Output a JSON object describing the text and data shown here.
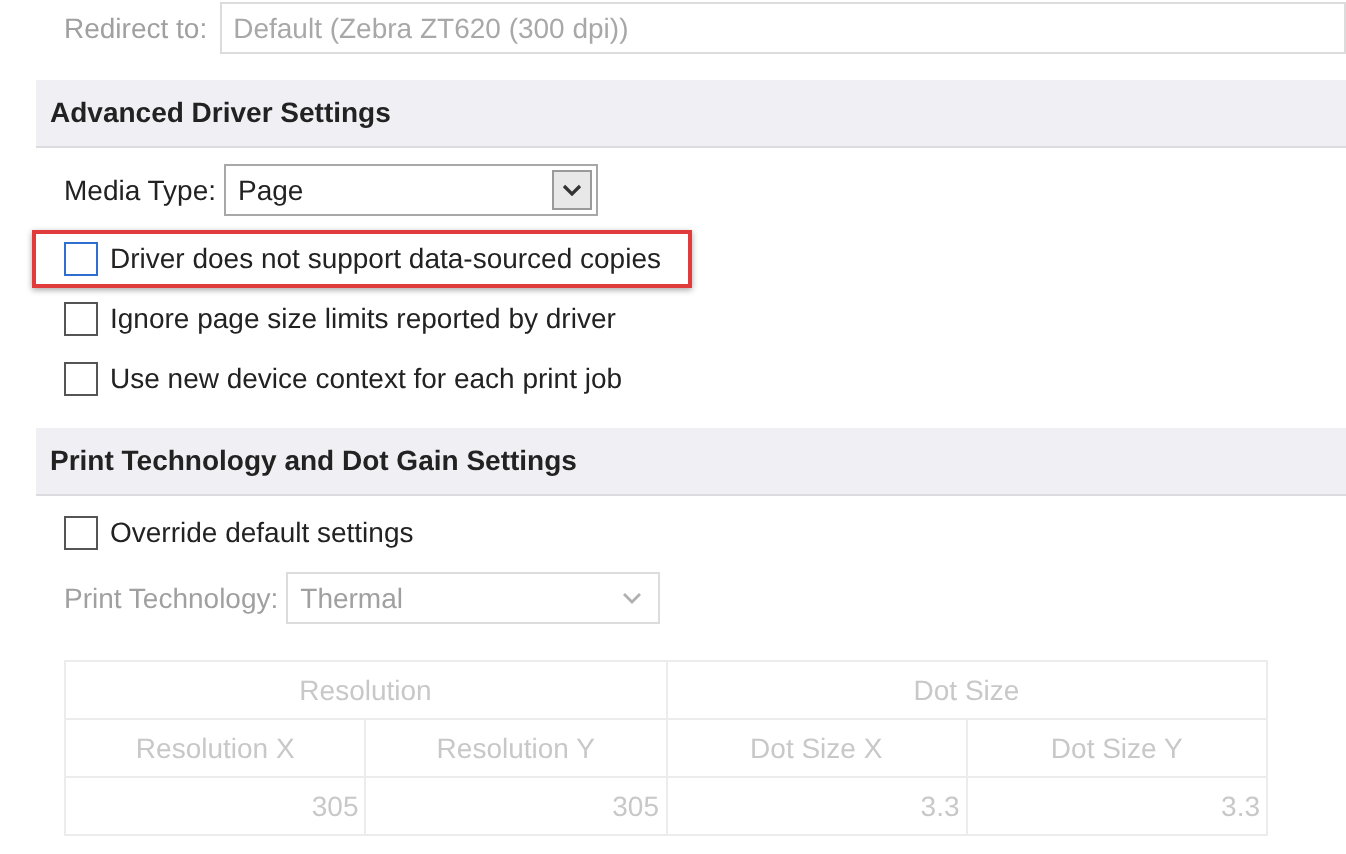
{
  "redirect": {
    "label": "Redirect to:",
    "value": "Default (Zebra ZT620 (300 dpi))",
    "disabled": true
  },
  "advanced": {
    "title": "Advanced Driver Settings",
    "media_type": {
      "label": "Media Type:",
      "value": "Page",
      "disabled": false
    },
    "options": [
      {
        "label": "Driver does not support data-sourced copies",
        "checked": false,
        "highlighted": true
      },
      {
        "label": "Ignore page size limits reported by driver",
        "checked": false,
        "highlighted": false
      },
      {
        "label": "Use new device context for each print job",
        "checked": false,
        "highlighted": false
      }
    ]
  },
  "print_technology": {
    "title": "Print Technology and Dot Gain Settings",
    "override": {
      "label": "Override default settings",
      "checked": false
    },
    "technology": {
      "label": "Print Technology:",
      "value": "Thermal",
      "disabled": true
    },
    "table": {
      "disabled": true,
      "groups": [
        "Resolution",
        "Dot Size"
      ],
      "columns": [
        "Resolution X",
        "Resolution Y",
        "Dot Size X",
        "Dot Size Y"
      ],
      "rows": [
        [
          "305",
          "305",
          "3.3",
          "3.3"
        ]
      ]
    }
  }
}
